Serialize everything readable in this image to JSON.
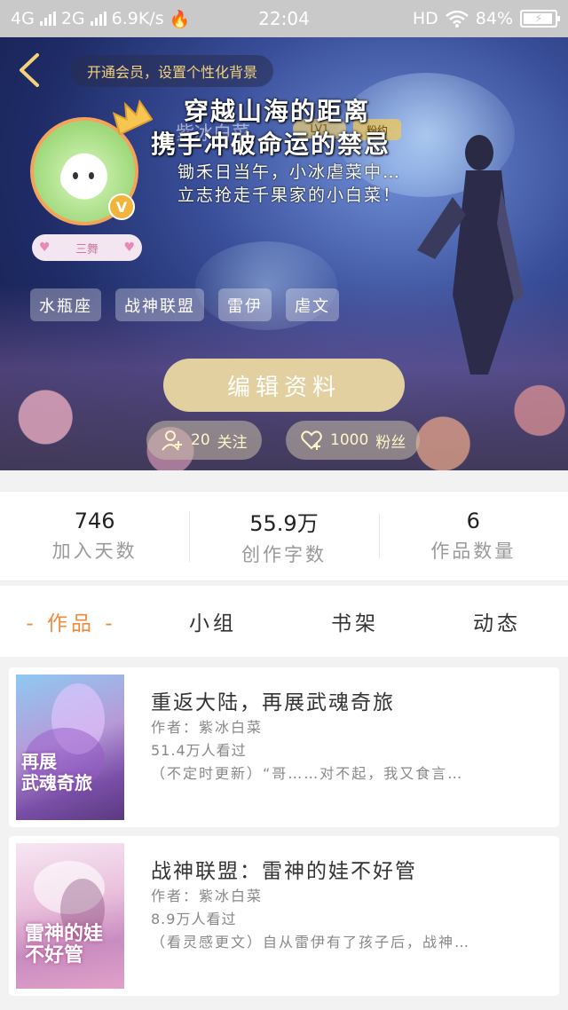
{
  "status_bar": {
    "network1": "4G",
    "network2": "2G",
    "speed": "6.9K/s",
    "time": "22:04",
    "hd": "HD",
    "battery": "84%"
  },
  "header": {
    "vip_prompt": "开通会员，设置个性化背景",
    "name_ghost": "紫冰白菜",
    "lv_ghost": "LV1",
    "fans_badge_ghost": "粉约",
    "level_badge": "三舞",
    "v_badge": "V",
    "signature": {
      "line1": "穿越山海的距离",
      "line2": "携手冲破命运的禁忌",
      "line3": "锄禾日当午，小冰虐菜中…",
      "line4": "立志抢走千果家的小白菜！"
    },
    "tags": [
      "水瓶座",
      "战神联盟",
      "雷伊",
      "虐文"
    ],
    "edit_button": "编辑资料",
    "follow_count": "20",
    "follow_label": "关注",
    "fans_count": "1000",
    "fans_label": "粉丝"
  },
  "stats": [
    {
      "value": "746",
      "label": "加入天数"
    },
    {
      "value": "55.9万",
      "label": "创作字数"
    },
    {
      "value": "6",
      "label": "作品数量"
    }
  ],
  "tabs": [
    {
      "label": "- 作品 -",
      "active": true
    },
    {
      "label": "小组",
      "active": false
    },
    {
      "label": "书架",
      "active": false
    },
    {
      "label": "动态",
      "active": false
    }
  ],
  "books": [
    {
      "title": "重返大陆，再展武魂奇旅",
      "author": "作者：紫冰白菜",
      "views": "51.4万人看过",
      "desc": "（不定时更新）“哥……对不起，我又食言…",
      "cover_text": "再展\n武魂奇旅"
    },
    {
      "title": "战神联盟：雷神的娃不好管",
      "author": "作者：紫冰白菜",
      "views": "8.9万人看过",
      "desc": "（看灵感更文）自从雷伊有了孩子后，战神…",
      "cover_text": "雷神的娃\n不好管"
    }
  ],
  "colors": {
    "accent": "#f08a3c",
    "edit_button": "#e3d0a0",
    "vip_text": "#f3d27a"
  }
}
